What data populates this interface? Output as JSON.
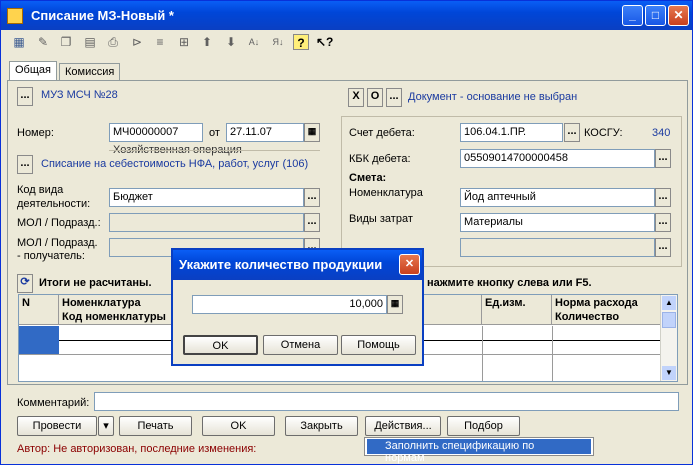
{
  "window": {
    "title": "Списание МЗ-Новый *",
    "min": "_",
    "max": "□",
    "close": "✕"
  },
  "toolbar": [
    "table-icon",
    "edit-icon",
    "copy-icon",
    "delete-icon",
    "print-icon",
    "filter-icon",
    "sort-icon",
    "grid-icon",
    "up-icon",
    "down-icon",
    "sort-asc-icon",
    "sort-desc-icon",
    "help-icon",
    "pointer-help-icon"
  ],
  "tabs": [
    {
      "label": "Общая"
    },
    {
      "label": "Комиссия"
    }
  ],
  "org": {
    "dots": "...",
    "name": "МУЗ МСЧ №28"
  },
  "docbase": {
    "x_btn": "X",
    "o_btn": "O",
    "dots": "...",
    "text": "Документ - основание не выбран"
  },
  "number": {
    "label": "Номер:",
    "value": "МЧ00000007",
    "date_label": "от",
    "date": "27.11.07"
  },
  "operation": {
    "group": "Хозяйственная операция",
    "dots": "...",
    "text": "Списание на себестоимость НФА, работ, услуг (106)"
  },
  "activity": {
    "label1": "Код вида",
    "label2": "деятельности:",
    "value": "Бюджет"
  },
  "mol1": {
    "label": "МОЛ / Подразд.:",
    "value": ""
  },
  "mol2": {
    "label1": "МОЛ / Подразд.",
    "label2": "- получатель:",
    "value": ""
  },
  "debit": {
    "label": "Счет дебета:",
    "value": "106.04.1.ПР.",
    "kosgu_label": "КОСГУ:",
    "kosgu": "340"
  },
  "kbk": {
    "label": "КБК дебета:",
    "value": "05509014700000458"
  },
  "smeta": {
    "label": "Смета:",
    "nom_label": "Номенклатура",
    "nom_value": "Йод аптечный",
    "cost_label": "Виды затрат",
    "cost_value": "Материалы",
    "extra_value": ""
  },
  "totals": {
    "text": "Итоги не расчитаны.",
    "hint": "нажмите кнопку слева или F5."
  },
  "grid": {
    "columns": [
      {
        "top": "N",
        "bottom": ""
      },
      {
        "top": "Номенклатура",
        "bottom": "Код номенклатуры"
      },
      {
        "top": "",
        "bottom": ""
      },
      {
        "top": "Ед.изм.",
        "bottom": ""
      },
      {
        "top": "Норма расхода",
        "bottom": "Количество"
      }
    ]
  },
  "comment": {
    "label": "Комментарий:",
    "value": ""
  },
  "buttons": {
    "post": "Провести",
    "print": "Печать",
    "ok": "OK",
    "close": "Закрыть",
    "actions": "Действия...",
    "select": "Подбор"
  },
  "footer": {
    "author": "Автор: Не авторизован, последние изменения:"
  },
  "popup": {
    "item": "Заполнить спецификацию по нормам"
  },
  "dialog": {
    "title": "Укажите количество продукции",
    "value": "10,000",
    "ok": "OK",
    "cancel": "Отмена",
    "help": "Помощь"
  }
}
